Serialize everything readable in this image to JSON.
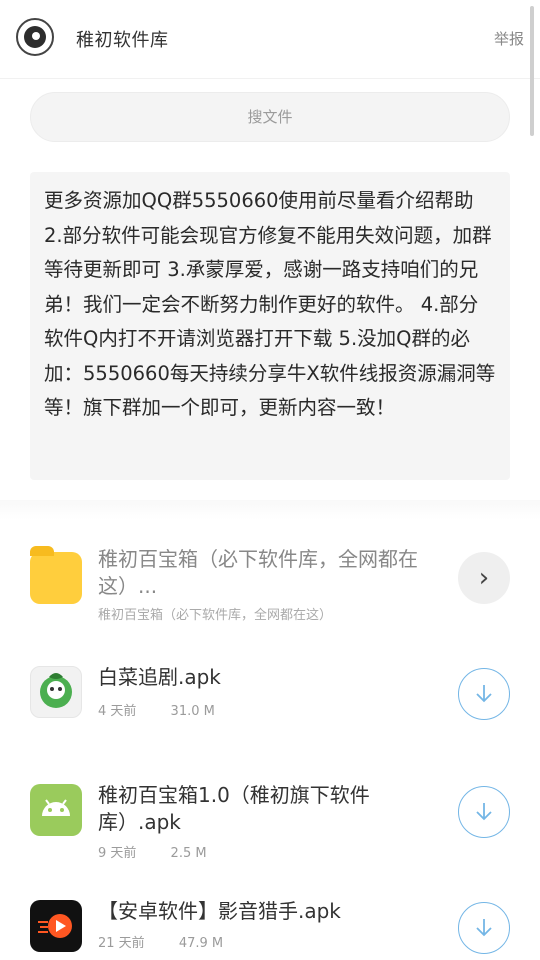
{
  "header": {
    "title": "稚初软件库",
    "report_label": "举报"
  },
  "search": {
    "placeholder": "搜文件"
  },
  "notice": {
    "text": "更多资源加QQ群5550660使用前尽量看介绍帮助 2.部分软件可能会现官方修复不能用失效问题，加群等待更新即可 3.承蒙厚爱，感谢一路支持咱们的兄弟！我们一定会不断努力制作更好的软件。 4.部分软件Q内打不开请浏览器打开下载 5.没加Q群的必加：5550660每天持续分享牛X软件线报资源漏洞等等！旗下群加一个即可，更新内容一致！"
  },
  "folder": {
    "name": "稚初百宝箱（必下软件库，全网都在这）...",
    "subtitle": "稚初百宝箱（必下软件库，全网都在这）",
    "icon": "folder-icon",
    "action_icon": "chevron-right-icon"
  },
  "files": [
    {
      "name": "白菜追剧.apk",
      "age": "4 天前",
      "size": "31.0 M",
      "icon": "cabbage-app-icon"
    },
    {
      "name": "稚初百宝箱1.0（稚初旗下软件库）.apk",
      "age": "9 天前",
      "size": "2.5 M",
      "icon": "android-app-icon"
    },
    {
      "name": "【安卓软件】影音猎手.apk",
      "age": "21 天前",
      "size": "47.9 M",
      "icon": "video-app-icon"
    }
  ],
  "colors": {
    "accent": "#74b6e6",
    "folder": "#ffce3d",
    "android": "#9acb5c"
  }
}
